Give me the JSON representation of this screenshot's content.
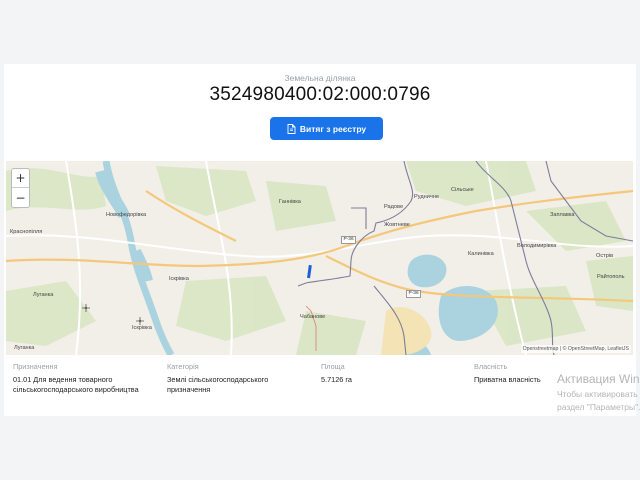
{
  "parcel": {
    "subtitle": "Земельна ділянка",
    "cadastral_number": "3524980400:02:000:0796",
    "extract_button_label": "Витяг з реєстру"
  },
  "map": {
    "zoom_in": "+",
    "zoom_out": "−",
    "attribution": "Openstreetmap | © OpenStreetMap, LeafletJS",
    "labels": {
      "novofedorivka": "Новофедорівка",
      "krasnopillia": "Краснопілля",
      "luhanka1": "Луганка",
      "luhanka2": "Луганка",
      "iskrivka1": "Іскрівка",
      "iskrivka2": "Іскрівка",
      "hannivka": "Ганнівка",
      "chabanove": "Чабанове",
      "radivka": "Радове",
      "rudnychne": "Рудничне",
      "silske": "Сільське",
      "zhovtneve": "Жовтневе",
      "kalynivka": "Калинівка",
      "volodymyrivka": "Володимирівка",
      "zaplavka": "Заплавка",
      "ostriv": "Острів",
      "raitopol": "Райтополь"
    },
    "road_r36a": "Р-36",
    "road_r36b": "Р-36"
  },
  "attributes": [
    {
      "label": "Призначення",
      "value": "01.01 Для ведення товарного сільськогосподарського виробництва"
    },
    {
      "label": "Категорія",
      "value": "Землі сільськогосподарського призначення"
    },
    {
      "label": "Площа",
      "value": "5.7126 га"
    },
    {
      "label": "Власність",
      "value": "Приватна власність"
    }
  ],
  "watermark": {
    "line1": "Активация Windows",
    "line2": "Чтобы активировать Windows,",
    "line3": "раздел \"Параметры\"."
  },
  "colors": {
    "accent": "#1a73e8",
    "water": "#aad3df",
    "parcel": "#1a5fd6"
  }
}
